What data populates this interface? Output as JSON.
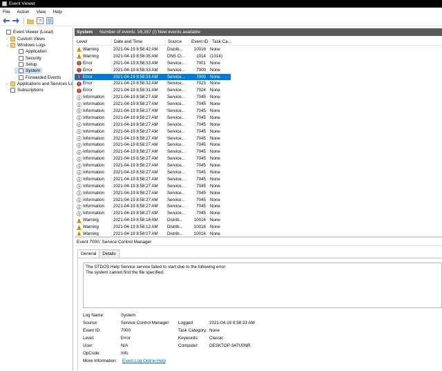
{
  "window": {
    "title": "Event Viewer"
  },
  "menu": [
    "File",
    "Action",
    "View",
    "Help"
  ],
  "tree": [
    {
      "label": "Event Viewer (Local)",
      "level": 0,
      "expander": "",
      "icon": "log"
    },
    {
      "label": "Custom Views",
      "level": 1,
      "expander": "›",
      "icon": "folder"
    },
    {
      "label": "Windows Logs",
      "level": 1,
      "expander": "⌄",
      "icon": "folder"
    },
    {
      "label": "Application",
      "level": 2,
      "expander": "",
      "icon": "log"
    },
    {
      "label": "Security",
      "level": 2,
      "expander": "",
      "icon": "log"
    },
    {
      "label": "Setup",
      "level": 2,
      "expander": "",
      "icon": "log"
    },
    {
      "label": "System",
      "level": 2,
      "expander": "",
      "icon": "log",
      "selected": true
    },
    {
      "label": "Forwarded Events",
      "level": 2,
      "expander": "",
      "icon": "log"
    },
    {
      "label": "Applications and Services Lo",
      "level": 1,
      "expander": "›",
      "icon": "folder"
    },
    {
      "label": "Subscriptions",
      "level": 1,
      "expander": "",
      "icon": "log"
    }
  ],
  "pane": {
    "name": "System",
    "summary": "Number of events: 59,397 (!) New events available"
  },
  "columns": {
    "level": "Level",
    "date": "Date and Time",
    "source": "Source",
    "id": "Event ID",
    "category": "Task Ca..."
  },
  "events": [
    {
      "level": "Warning",
      "date": "2021-04-19 8:58:42 AM",
      "source": "Distrib...",
      "id": "10016",
      "category": "None"
    },
    {
      "level": "Warning",
      "date": "2021-04-19 8:58:35 AM",
      "source": "DNS Cl...",
      "id": "1014",
      "category": "(1014)"
    },
    {
      "level": "Error",
      "date": "2021-04-19 8:58:33 AM",
      "source": "Service...",
      "id": "7001",
      "category": "None"
    },
    {
      "level": "Error",
      "date": "2021-04-19 8:58:33 AM",
      "source": "Service...",
      "id": "7000",
      "category": "None"
    },
    {
      "level": "Error",
      "date": "2021-04-19 8:58:33 AM",
      "source": "Service...",
      "id": "7000",
      "category": "None",
      "selected": true
    },
    {
      "level": "Error",
      "date": "2021-04-19 8:58:32 AM",
      "source": "Service...",
      "id": "7023",
      "category": "None"
    },
    {
      "level": "Error",
      "date": "2021-04-19 8:58:31 AM",
      "source": "Service...",
      "id": "7024",
      "category": "None"
    },
    {
      "level": "Information",
      "date": "2021-04-19 8:58:27 AM",
      "source": "Service...",
      "id": "7045",
      "category": "None"
    },
    {
      "level": "Information",
      "date": "2021-04-19 8:58:27 AM",
      "source": "Service...",
      "id": "7045",
      "category": "None"
    },
    {
      "level": "Information",
      "date": "2021-04-19 8:58:27 AM",
      "source": "Service...",
      "id": "7045",
      "category": "None"
    },
    {
      "level": "Information",
      "date": "2021-04-19 8:58:27 AM",
      "source": "Service...",
      "id": "7045",
      "category": "None"
    },
    {
      "level": "Information",
      "date": "2021-04-19 8:58:27 AM",
      "source": "Service...",
      "id": "7045",
      "category": "None"
    },
    {
      "level": "Information",
      "date": "2021-04-19 8:58:27 AM",
      "source": "Service...",
      "id": "7045",
      "category": "None"
    },
    {
      "level": "Information",
      "date": "2021-04-19 8:58:27 AM",
      "source": "Service...",
      "id": "7045",
      "category": "None"
    },
    {
      "level": "Information",
      "date": "2021-04-19 8:58:27 AM",
      "source": "Service...",
      "id": "7045",
      "category": "None"
    },
    {
      "level": "Information",
      "date": "2021-04-19 8:58:27 AM",
      "source": "Service...",
      "id": "7045",
      "category": "None"
    },
    {
      "level": "Information",
      "date": "2021-04-19 8:58:27 AM",
      "source": "Service...",
      "id": "7045",
      "category": "None"
    },
    {
      "level": "Information",
      "date": "2021-04-19 8:58:27 AM",
      "source": "Service...",
      "id": "7045",
      "category": "None"
    },
    {
      "level": "Information",
      "date": "2021-04-19 8:58:27 AM",
      "source": "Service...",
      "id": "7045",
      "category": "None"
    },
    {
      "level": "Information",
      "date": "2021-04-19 8:58:27 AM",
      "source": "Service...",
      "id": "7045",
      "category": "None"
    },
    {
      "level": "Information",
      "date": "2021-04-19 8:58:27 AM",
      "source": "Service...",
      "id": "7045",
      "category": "None"
    },
    {
      "level": "Information",
      "date": "2021-04-19 8:58:27 AM",
      "source": "Service...",
      "id": "7045",
      "category": "None"
    },
    {
      "level": "Information",
      "date": "2021-04-19 8:58:27 AM",
      "source": "Service...",
      "id": "7045",
      "category": "None"
    },
    {
      "level": "Information",
      "date": "2021-04-19 8:58:27 AM",
      "source": "Service...",
      "id": "7045",
      "category": "None"
    },
    {
      "level": "Information",
      "date": "2021-04-19 8:58:27 AM",
      "source": "Service...",
      "id": "7045",
      "category": "None"
    },
    {
      "level": "Warning",
      "date": "2021-04-19 8:58:18 AM",
      "source": "Distrib...",
      "id": "10016",
      "category": "None"
    },
    {
      "level": "Warning",
      "date": "2021-04-19 8:58:12 AM",
      "source": "Distrib...",
      "id": "10016",
      "category": "None"
    },
    {
      "level": "Warning",
      "date": "2021-04-19 8:58:07 AM",
      "source": "Distrib...",
      "id": "10016",
      "category": "None"
    },
    {
      "level": "Information",
      "date": "2021-04-19 8:57:49 AM",
      "source": "UserPnp",
      "id": "20003",
      "category": "(7005)"
    },
    {
      "level": "Warning",
      "date": "2021-04-19 8:57:47 AM",
      "source": "Distrib...",
      "id": "10016",
      "category": "None"
    }
  ],
  "detail": {
    "header": "Event 7000, Service Control Manager",
    "tabs": [
      "General",
      "Details"
    ],
    "message_line1": "The STDOS Help Service service failed to start due to the following error:",
    "message_line2": "The system cannot find the file specified.",
    "labels": {
      "log_name": "Log Name:",
      "source": "Source:",
      "event_id": "Event ID:",
      "level": "Level:",
      "user": "User:",
      "opcode": "OpCode:",
      "more_info": "More Information:",
      "logged": "Logged:",
      "task_category": "Task Category:",
      "keywords": "Keywords:",
      "computer": "Computer:"
    },
    "values": {
      "log_name": "System",
      "source": "Service Control Manager",
      "event_id": "7000",
      "level": "Error",
      "user": "N/A",
      "opcode": "Info",
      "more_info": "Event Log Online Help",
      "logged": "2021-04-19 8:58:33 AM",
      "task_category": "None",
      "keywords": "Classic",
      "computer": "DESKTOP-347U0NR"
    }
  },
  "colors": {
    "selection": "#0078d7",
    "header_bar": "#5a5a5a",
    "warning": "#f5c211",
    "error": "#c42b1c",
    "info": "#ffffff"
  }
}
